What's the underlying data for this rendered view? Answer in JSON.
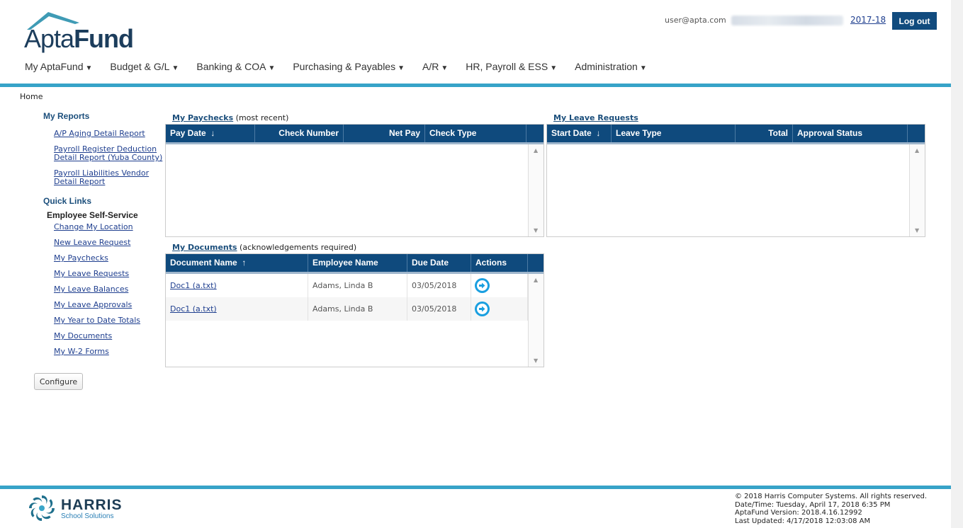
{
  "header": {
    "logo_light": "Apta",
    "logo_bold": "Fund",
    "user_email": "user@apta.com",
    "fiscal_year": "2017-18",
    "logout_label": "Log out"
  },
  "nav": [
    "My AptaFund",
    "Budget & G/L",
    "Banking & COA",
    "Purchasing & Payables",
    "A/R",
    "HR, Payroll & ESS",
    "Administration"
  ],
  "breadcrumb": "Home",
  "sidebar": {
    "reports_heading": "My Reports",
    "reports": [
      "A/P Aging Detail Report",
      "Payroll Register Deduction Detail Report (Yuba County)",
      "Payroll Liabilities Vendor Detail Report"
    ],
    "quick_heading": "Quick Links",
    "ess_heading": "Employee Self-Service",
    "links": [
      "Change My Location",
      "New Leave Request",
      "My Paychecks",
      "My Leave Requests",
      "My Leave Balances",
      "My Leave Approvals",
      "My Year to Date Totals",
      "My Documents",
      "My W-2 Forms"
    ],
    "configure_label": "Configure"
  },
  "paychecks": {
    "title": "My Paychecks",
    "note": "(most recent)",
    "columns": [
      "Pay Date",
      "Check Number",
      "Net Pay",
      "Check Type"
    ],
    "sort_icon": "↓"
  },
  "leave_requests": {
    "title": "My Leave Requests",
    "columns": [
      "Start Date",
      "Leave Type",
      "Total",
      "Approval Status"
    ],
    "sort_icon": "↓"
  },
  "documents": {
    "title": "My Documents",
    "note": "(acknowledgements required)",
    "columns": [
      "Document Name",
      "Employee Name",
      "Due Date",
      "Actions"
    ],
    "sort_icon": "↑",
    "rows": [
      {
        "document": "Doc1 (a.txt)",
        "employee": "Adams, Linda B",
        "due": "03/05/2018",
        "action_icon": "arrow-right-circle-icon"
      },
      {
        "document": "Doc1 (a.txt)",
        "employee": "Adams, Linda B",
        "due": "03/05/2018",
        "action_icon": "arrow-right-circle-icon"
      }
    ]
  },
  "footer": {
    "brand": "HARRIS",
    "brand_sub": "School Solutions",
    "copyright": "© 2018 Harris Computer Systems. All rights reserved.",
    "datetime": "Date/Time: Tuesday, April 17, 2018 6:35 PM",
    "version": "AptaFund Version: 2018.4.16.12992",
    "last_updated": "Last Updated: 4/17/2018 12:03:08 AM"
  },
  "colors": {
    "header_blue": "#0f4a7d",
    "accent_bar": "#37a3c8",
    "link": "#1f3f8f",
    "action_icon": "#1a9fe0"
  }
}
